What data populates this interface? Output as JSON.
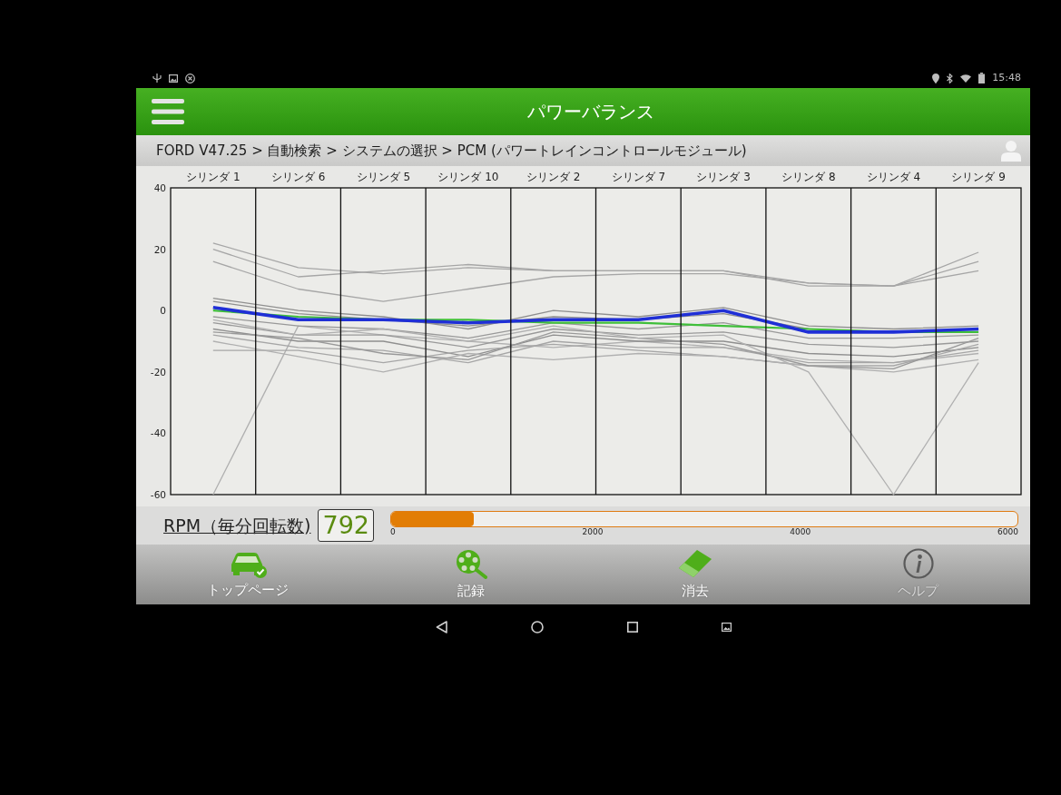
{
  "status_bar": {
    "time": "15:48"
  },
  "header": {
    "title": "パワーバランス"
  },
  "breadcrumb": "FORD V47.25 > 自動検索 > システムの選択 > PCM (パワートレインコントロールモジュール)",
  "chart": {
    "chart_data": {
      "type": "line",
      "categories": [
        "シリンダ 1",
        "シリンダ 6",
        "シリンダ 5",
        "シリンダ 10",
        "シリンダ 2",
        "シリンダ 7",
        "シリンダ 3",
        "シリンダ 8",
        "シリンダ 4",
        "シリンダ 9"
      ],
      "ylim": [
        -60,
        40
      ],
      "yticks": [
        40,
        20,
        0,
        -20,
        -40,
        -60
      ],
      "series": [
        {
          "color": "#a6a6a6",
          "values": [
            22,
            14,
            12,
            14,
            13,
            13,
            13,
            8,
            8,
            16
          ]
        },
        {
          "color": "#a6a6a6",
          "values": [
            20,
            11,
            13,
            15,
            13,
            13,
            13,
            9,
            8,
            19
          ]
        },
        {
          "color": "#a6a6a6",
          "values": [
            16,
            7,
            3,
            7,
            11,
            12,
            12,
            9,
            8,
            13
          ]
        },
        {
          "color": "#b0b0b0",
          "values": [
            -60,
            -5,
            -8,
            -10,
            -12,
            -10,
            -12,
            -16,
            -17,
            -14
          ]
        },
        {
          "color": "#8f8f8f",
          "values": [
            3,
            -1,
            -3,
            -5,
            -2,
            -3,
            -1,
            -6,
            -7,
            -6
          ]
        },
        {
          "color": "#8f8f8f",
          "values": [
            4,
            0,
            -2,
            -6,
            0,
            -2,
            1,
            -5,
            -6,
            -5
          ]
        },
        {
          "color": "#999999",
          "values": [
            -2,
            -5,
            -6,
            -9,
            -4,
            -6,
            -4,
            -9,
            -9,
            -8
          ]
        },
        {
          "color": "#999999",
          "values": [
            -4,
            -8,
            -8,
            -12,
            -6,
            -8,
            -7,
            -11,
            -12,
            -10
          ]
        },
        {
          "color": "#8f8f8f",
          "values": [
            -6,
            -10,
            -10,
            -15,
            -8,
            -10,
            -10,
            -14,
            -15,
            -12
          ]
        },
        {
          "color": "#a6a6a6",
          "values": [
            -8,
            -12,
            -13,
            -17,
            -10,
            -12,
            -12,
            -17,
            -17,
            -13
          ]
        },
        {
          "color": "#a6a6a6",
          "values": [
            -13,
            -13,
            -17,
            -13,
            -11,
            -13,
            -15,
            -18,
            -18,
            -11
          ]
        },
        {
          "color": "#b0b0b0",
          "values": [
            -10,
            -15,
            -20,
            -14,
            -16,
            -14,
            -15,
            -18,
            -20,
            -16
          ]
        },
        {
          "color": "#999999",
          "values": [
            -7,
            -9,
            -14,
            -16,
            -7,
            -9,
            -11,
            -18,
            -19,
            -9
          ]
        },
        {
          "color": "#b0b0b0",
          "values": [
            -3,
            -8,
            -6,
            -10,
            -5,
            -9,
            -8,
            -20,
            -60,
            -17
          ]
        },
        {
          "color": "#3fbf3a",
          "values": [
            0,
            -2,
            -3,
            -3,
            -4,
            -4,
            -5,
            -6,
            -7,
            -7
          ]
        },
        {
          "color": "#1f2fd6",
          "values": [
            1,
            -3,
            -3,
            -4,
            -3,
            -3,
            0,
            -7,
            -7,
            -6
          ]
        }
      ]
    }
  },
  "rpm": {
    "label": "RPM（毎分回転数)",
    "value": "792",
    "level": 0.132,
    "scale_labels": [
      "0",
      "2000",
      "4000",
      "6000"
    ]
  },
  "bottom_nav": [
    {
      "label": "トップページ",
      "disabled": false
    },
    {
      "label": "記録",
      "disabled": false
    },
    {
      "label": "消去",
      "disabled": false
    },
    {
      "label": "ヘルプ",
      "disabled": true
    }
  ]
}
